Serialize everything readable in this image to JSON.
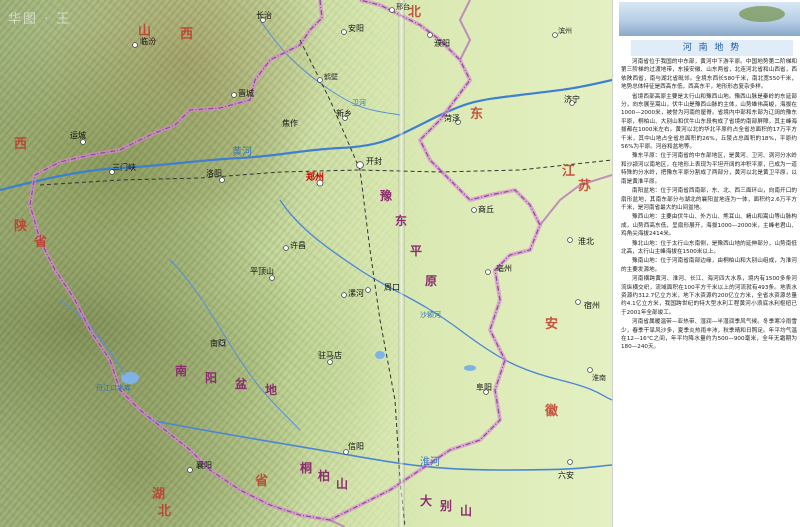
{
  "watermark": "华图 ·  王",
  "sidebar": {
    "title": "河 南 地 势",
    "paragraphs": [
      "河南省位于我国的中东部，黄河中下游平原。中国地势第二阶梯和第三阶梯的过渡地带，东接安徽、山东两省，北连河北省和山西省，西依陕西省，南与湖北省毗邻。全境东西长580千米，南北宽550千米，地势总体特征是西高东低，西高东平，地形形态复杂多样。",
      "省境西部高原主要是太行山和豫西山地。豫西山脉是秦岭的东延部分，向东展至嵩山，伏牛山是豫西山脉的主体，山势雄伟高峻，海拔在1000—2000米，被誉为河南的屋脊。省境内中部和东部为辽阔的豫东平原，桐柏山、大别山和伏牛山东段构成了省境的南部屏障，其主峰海拔都在1000米左右。黄河以北的华北平原约占全省总面积的17万平方千米，其中山地占全省总面积的26%，丘陵占总面积的18%，平原约56%为平原。河谷和盆地等。",
      "豫东平原：位于河南省的中东部地区，是黄河、卫河、涡河分水岭和沙颍河以南地区，在地形上表现为平坦开阔的冲积平原，已成为一道特殊的分水岭，把豫东平原分割成了两部分，黄河以北是黄卫平原，以南是黄淮平原。",
      "南阳盆地：位于河南省西南部，东、北、西三面环山，向南开口的扇形盆地，其南东部分与湖北的襄阳盆地连为一体，面积约2.6万平方千米，是河南省最大的山间盆地。",
      "豫西山地：主要由伏牛山、外方山、熊耳山、崤山和嵩山等山脉构成，山势西高东低，呈扇形展开，海拔1000—2000米，主峰老君山、鸡角尖海拔2414米。",
      "豫北山地：位于太行山东南侧，是豫西山地的延伸部分，山势南低北高，太行山主峰海拔在1500米以上。",
      "豫南山地：位于河南省南部边缘，由桐柏山和大别山组成，为淮河的主要发源地。",
      "河南横跨黄河、淮河、长江、海河四大水系，境内有1500多条河流纵横交织，流域面积在100平方千米以上的河流就有493条。地表水资源约312.7亿立方米，地下水资源约200亿立方米，全省水资源总量约4.1亿立方米，我国跨世纪的特大型水利工程黄河小浪底水利枢纽已于2001年全部竣工。",
      "河南省属暖温带—亚热带、湿润—半湿润季风气候。冬季寒冷雨雪少，春季干旱风沙多，夏季炎热雨丰沛，秋季晴和日照足。年平均气温在12—16℃之间，年平均降水量约为500—900毫米，全年无霜期为180—240天。"
    ]
  },
  "map": {
    "cities": [
      {
        "name": "运城"
      },
      {
        "name": "三门峡"
      },
      {
        "name": "洛阳"
      },
      {
        "name": "郑州",
        "kind": "capital"
      },
      {
        "name": "开封"
      },
      {
        "name": "安阳"
      },
      {
        "name": "濮阳"
      },
      {
        "name": "新乡"
      },
      {
        "name": "焦作"
      },
      {
        "name": "许昌"
      },
      {
        "name": "平顶山"
      },
      {
        "name": "漯河"
      },
      {
        "name": "周口"
      },
      {
        "name": "商丘"
      },
      {
        "name": "南阳"
      },
      {
        "name": "驻马店"
      },
      {
        "name": "信阳"
      },
      {
        "name": "襄阳"
      },
      {
        "name": "阜阳"
      },
      {
        "name": "菏泽"
      },
      {
        "name": "济宁"
      },
      {
        "name": "淮北"
      },
      {
        "name": "亳州"
      },
      {
        "name": "宿州"
      },
      {
        "name": "长治"
      },
      {
        "name": "晋城"
      },
      {
        "name": "临汾"
      },
      {
        "name": "六安"
      },
      {
        "name": "鹤壁"
      },
      {
        "name": "邢台"
      },
      {
        "name": "滨州"
      },
      {
        "name": "淮南"
      }
    ],
    "region_labels": [
      "西",
      "北",
      "东",
      "江",
      "苏",
      "安",
      "徽",
      "山",
      "西",
      "湖",
      "北",
      "省",
      "陕",
      "省",
      "南",
      "阳",
      "盆",
      "地",
      "豫",
      "东",
      "平",
      "原",
      "桐",
      "柏",
      "山",
      "大",
      "别",
      "山"
    ],
    "water_labels": [
      "黄河",
      "淮河",
      "丹江口水库",
      "沙颍河",
      "卫河"
    ]
  }
}
